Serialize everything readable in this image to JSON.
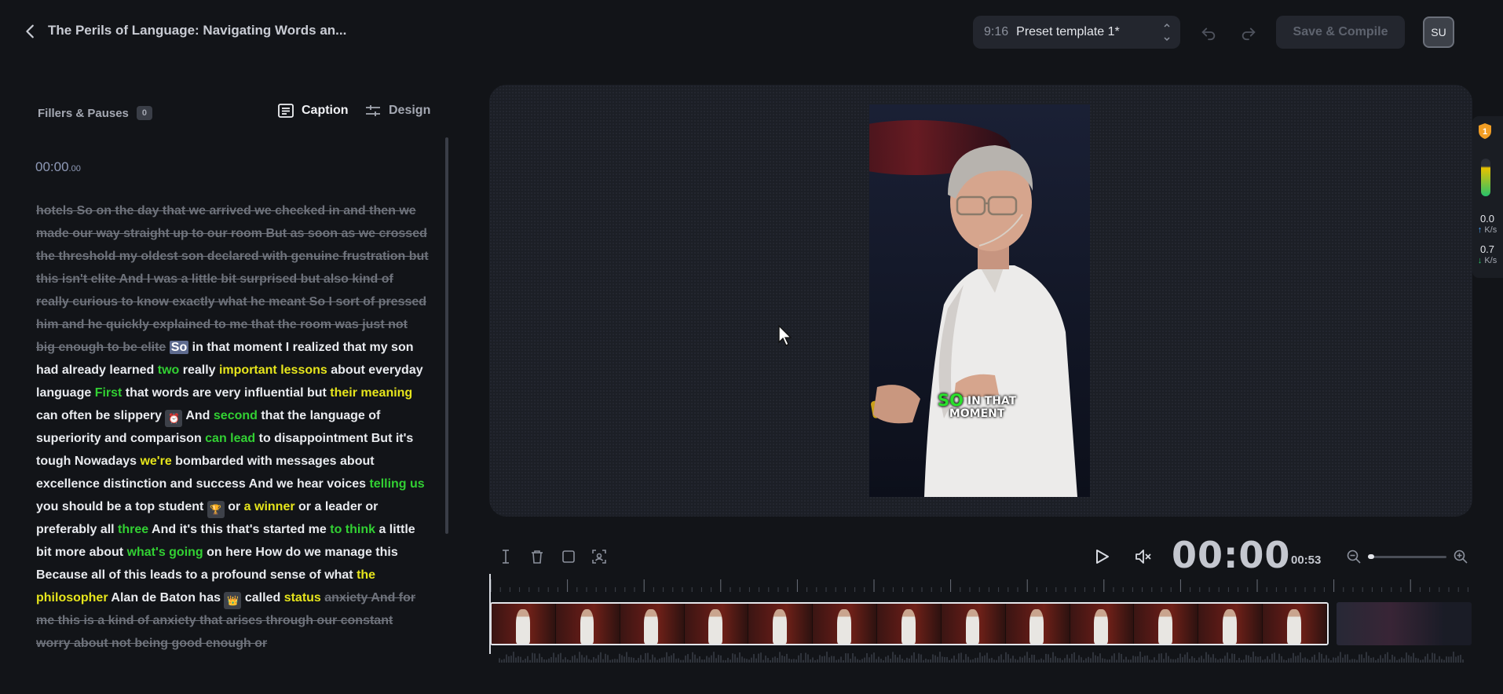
{
  "header": {
    "title": "The Perils of Language: Navigating Words an...",
    "template": {
      "ratio": "9:16",
      "name": "Preset template 1*"
    },
    "save_label": "Save & Compile",
    "avatar_initials": "SU"
  },
  "left_panel": {
    "fillers_label": "Fillers & Pauses",
    "fillers_count": "0",
    "tabs": {
      "caption": "Caption",
      "design": "Design"
    },
    "timecode": {
      "main": "00:00",
      "fraction": ".00"
    },
    "transcript": [
      {
        "t": "hotels So on the day that we arrived we checked in and then we made our way straight up to our room But as soon as we crossed the threshold my oldest son declared with genuine frustration but this isn't elite And I was a little bit surprised but also kind of really curious to know exactly what he meant So I sort of pressed him and he quickly explained to me that the room was just not big enough to be elite",
        "c": "s"
      },
      {
        "t": " "
      },
      {
        "t": "So",
        "c": "cur"
      },
      {
        "t": " in that moment I realized that my son had already learned "
      },
      {
        "t": "two",
        "c": "g"
      },
      {
        "t": " really "
      },
      {
        "t": "important lessons",
        "c": "y"
      },
      {
        "t": " about everyday language "
      },
      {
        "t": "First",
        "c": "g"
      },
      {
        "t": " that words are very influential but "
      },
      {
        "t": "their meaning",
        "c": "y"
      },
      {
        "t": " can often be slippery "
      },
      {
        "t": "⏰",
        "c": "emo"
      },
      {
        "t": " And "
      },
      {
        "t": "second",
        "c": "g"
      },
      {
        "t": " that the language of superiority and comparison "
      },
      {
        "t": "can lead",
        "c": "g"
      },
      {
        "t": " to disappointment But it's tough Nowadays "
      },
      {
        "t": "we're",
        "c": "y"
      },
      {
        "t": " bombarded with messages about excellence distinction and success And we hear voices "
      },
      {
        "t": "telling us",
        "c": "g"
      },
      {
        "t": " you should be a top student "
      },
      {
        "t": "🏆",
        "c": "emo"
      },
      {
        "t": " or "
      },
      {
        "t": "a winner",
        "c": "y"
      },
      {
        "t": " or a leader or preferably all "
      },
      {
        "t": "three",
        "c": "g"
      },
      {
        "t": " And it's this that's started me "
      },
      {
        "t": "to think",
        "c": "g"
      },
      {
        "t": " a little bit more about "
      },
      {
        "t": "what's going",
        "c": "g"
      },
      {
        "t": " on here How do we manage this Because all of this leads to a profound sense of what "
      },
      {
        "t": "the philosopher",
        "c": "y"
      },
      {
        "t": " Alan de Baton has "
      },
      {
        "t": "👑",
        "c": "emo"
      },
      {
        "t": " called "
      },
      {
        "t": "status",
        "c": "y"
      },
      {
        "t": " "
      },
      {
        "t": "anxiety And for me this is a kind of anxiety that arises through our constant worry about not being good enough or",
        "c": "s"
      }
    ]
  },
  "preview": {
    "subtitle": {
      "highlight": "SO",
      "line1": "IN THAT",
      "line2": "MOMENT"
    }
  },
  "side_panel": {
    "upload_value": "0.0",
    "upload_unit": "K/s",
    "download_value": "0.7",
    "download_unit": "K/s",
    "badge": "1"
  },
  "player": {
    "time_min": "00",
    "time_sep": ":",
    "time_sec": "00",
    "duration": "00:53",
    "zoom_level": 0.08
  },
  "colors": {
    "accent_green": "#32d033",
    "accent_yellow": "#e6e51c",
    "background": "#121418",
    "panel": "#1c1f26"
  }
}
